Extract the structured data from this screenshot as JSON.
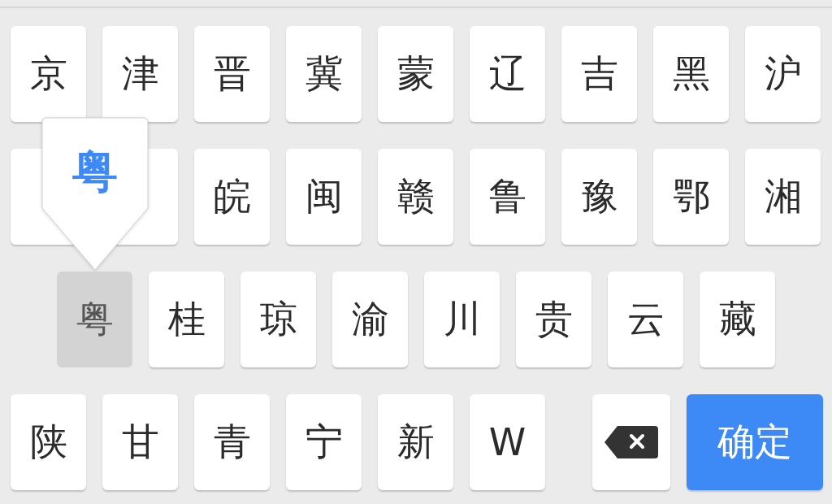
{
  "rows": [
    [
      {
        "kind": "char",
        "label": "京",
        "selected": false
      },
      {
        "kind": "char",
        "label": "津",
        "selected": false
      },
      {
        "kind": "char",
        "label": "晋",
        "selected": false
      },
      {
        "kind": "char",
        "label": "冀",
        "selected": false
      },
      {
        "kind": "char",
        "label": "蒙",
        "selected": false
      },
      {
        "kind": "char",
        "label": "辽",
        "selected": false
      },
      {
        "kind": "char",
        "label": "吉",
        "selected": false
      },
      {
        "kind": "char",
        "label": "黑",
        "selected": false
      },
      {
        "kind": "char",
        "label": "沪",
        "selected": false
      }
    ],
    [
      {
        "kind": "char",
        "selected": false
      },
      {
        "kind": "char",
        "selected": false
      },
      {
        "kind": "char",
        "label": "皖",
        "selected": false
      },
      {
        "kind": "char",
        "label": "闽",
        "selected": false
      },
      {
        "kind": "char",
        "label": "赣",
        "selected": false
      },
      {
        "kind": "char",
        "label": "鲁",
        "selected": false
      },
      {
        "kind": "char",
        "label": "豫",
        "selected": false
      },
      {
        "kind": "char",
        "label": "鄂",
        "selected": false
      },
      {
        "kind": "char",
        "label": "湘",
        "selected": false
      }
    ],
    [
      {
        "kind": "char",
        "label": "粤",
        "selected": true
      },
      {
        "kind": "char",
        "label": "桂",
        "selected": false
      },
      {
        "kind": "char",
        "label": "琼",
        "selected": false
      },
      {
        "kind": "char",
        "label": "渝",
        "selected": false
      },
      {
        "kind": "char",
        "label": "川",
        "selected": false
      },
      {
        "kind": "char",
        "label": "贵",
        "selected": false
      },
      {
        "kind": "char",
        "label": "云",
        "selected": false
      },
      {
        "kind": "char",
        "label": "藏",
        "selected": false
      }
    ],
    [
      {
        "kind": "char",
        "label": "陕",
        "selected": false
      },
      {
        "kind": "char",
        "label": "甘",
        "selected": false
      },
      {
        "kind": "char",
        "label": "青",
        "selected": false
      },
      {
        "kind": "char",
        "label": "宁",
        "selected": false
      },
      {
        "kind": "char",
        "label": "新",
        "selected": false
      },
      {
        "kind": "char",
        "label": "W",
        "selected": false
      },
      {
        "kind": "backspace"
      },
      {
        "kind": "confirm",
        "label": "确定"
      }
    ]
  ],
  "popup": {
    "label": "粤"
  }
}
